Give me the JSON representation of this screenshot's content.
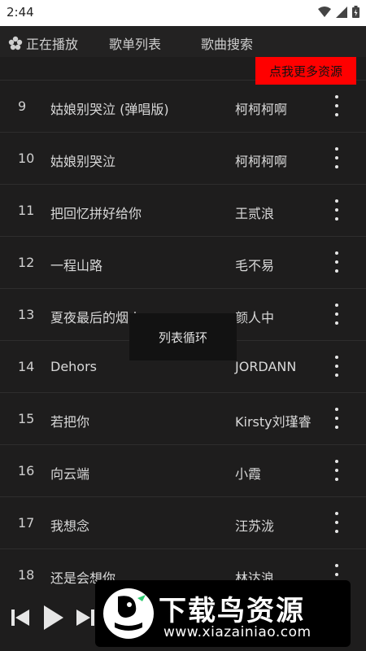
{
  "status": {
    "time": "2:44"
  },
  "nav": {
    "now_playing": "正在播放",
    "playlist": "歌单列表",
    "search": "歌曲搜索"
  },
  "promo": {
    "label": "点我更多资源"
  },
  "songs": [
    {
      "num": "9",
      "title": "姑娘别哭泣 (弹唱版)",
      "artist": "柯柯柯啊"
    },
    {
      "num": "10",
      "title": "姑娘别哭泣",
      "artist": "柯柯柯啊"
    },
    {
      "num": "11",
      "title": "把回忆拼好给你",
      "artist": "王贰浪"
    },
    {
      "num": "12",
      "title": "一程山路",
      "artist": "毛不易"
    },
    {
      "num": "13",
      "title": "夏夜最后的烟火",
      "artist": "颜人中"
    },
    {
      "num": "14",
      "title": "Dehors",
      "artist": "JORDANN"
    },
    {
      "num": "15",
      "title": "若把你",
      "artist": "Kirsty刘瑾睿"
    },
    {
      "num": "16",
      "title": "向云端",
      "artist": "小霞"
    },
    {
      "num": "17",
      "title": "我想念",
      "artist": "汪苏泷"
    },
    {
      "num": "18",
      "title": "还是会想你",
      "artist": "林达浪"
    }
  ],
  "toast": {
    "text": "列表循环"
  },
  "watermark": {
    "title": "下载鸟资源",
    "url": "www.xiazainiao.com"
  }
}
